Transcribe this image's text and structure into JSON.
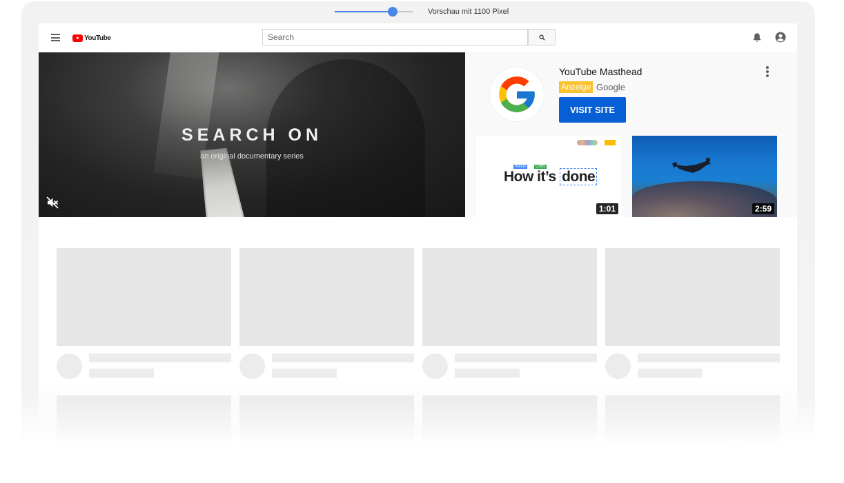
{
  "preview": {
    "label": "Vorschau mit 1100 Pixel",
    "slider_value_fraction": 0.74,
    "accent_color": "#4a86e8"
  },
  "header": {
    "menu_icon": "hamburger-menu-icon",
    "logo_text": "YouTube",
    "search_placeholder": "Search",
    "search_icon": "search-icon",
    "notifications_icon": "bell-icon",
    "account_icon": "account-circle-icon"
  },
  "masthead": {
    "video": {
      "title": "SEARCH ON",
      "subtitle": "an original documentary series",
      "mute_icon": "muted-speaker-icon"
    },
    "ad": {
      "title": "YouTube Masthead",
      "badge": "Anzeige",
      "advertiser": "Google",
      "cta": "VISIT SITE",
      "cta_color": "#065fd4",
      "badge_color": "#f9c22e"
    },
    "thumbnails": [
      {
        "duration": "1:01",
        "text_a": "How",
        "text_b": "it’s",
        "text_c": "done",
        "tag_a": "Alexis",
        "tag_c": "Chris"
      },
      {
        "duration": "2:59"
      }
    ]
  },
  "skeleton": {
    "columns": 4,
    "rows": 2
  }
}
